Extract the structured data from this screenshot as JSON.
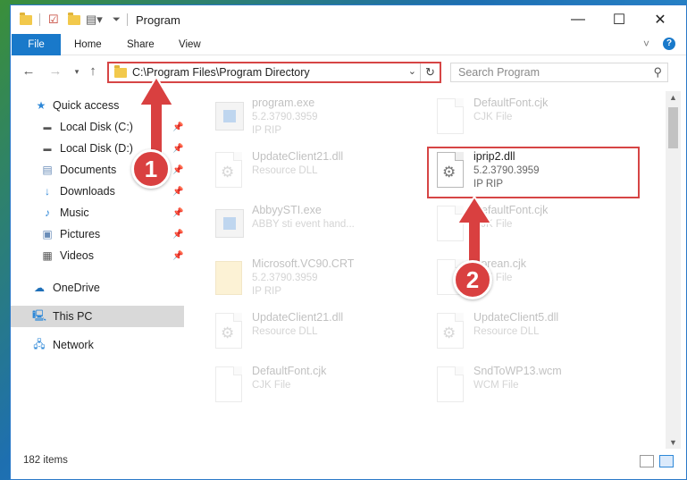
{
  "window": {
    "title": "Program",
    "controls": {
      "minimize": "—",
      "maximize": "☐",
      "close": "✕"
    }
  },
  "ribbon": {
    "tabs": [
      "File",
      "Home",
      "Share",
      "View"
    ],
    "expand_icon": "˅",
    "help_icon": "?"
  },
  "address": {
    "path": "C:\\Program Files\\Program Directory",
    "search_placeholder": "Search Program"
  },
  "sidebar": {
    "items": [
      {
        "label": "Quick access",
        "icon": "star-icon",
        "pinned": false
      },
      {
        "label": "Local Disk (C:)",
        "icon": "drive-icon",
        "pinned": true
      },
      {
        "label": "Local Disk (D:)",
        "icon": "drive-icon",
        "pinned": true
      },
      {
        "label": "Documents",
        "icon": "documents-icon",
        "pinned": true
      },
      {
        "label": "Downloads",
        "icon": "download-icon",
        "pinned": true
      },
      {
        "label": "Music",
        "icon": "music-icon",
        "pinned": true
      },
      {
        "label": "Pictures",
        "icon": "pictures-icon",
        "pinned": true
      },
      {
        "label": "Videos",
        "icon": "videos-icon",
        "pinned": true
      },
      {
        "label": "OneDrive",
        "icon": "cloud-icon",
        "pinned": false
      },
      {
        "label": "This PC",
        "icon": "pc-icon",
        "pinned": false
      },
      {
        "label": "Network",
        "icon": "network-icon",
        "pinned": false
      }
    ]
  },
  "files": [
    {
      "name": "program.exe",
      "line1": "5.2.3790.3959",
      "line2": "IP RIP",
      "icon": "exe"
    },
    {
      "name": "DefaultFont.cjk",
      "line1": "CJK File",
      "line2": "",
      "icon": "doc"
    },
    {
      "name": "UpdateClient21.dll",
      "line1": "Resource DLL",
      "line2": "",
      "icon": "dll"
    },
    {
      "name": "iprip2.dll",
      "line1": "5.2.3790.3959",
      "line2": "IP RIP",
      "icon": "dll"
    },
    {
      "name": "AbbyySTI.exe",
      "line1": "ABBY sti event hand...",
      "line2": "",
      "icon": "exe"
    },
    {
      "name": "DefaultFont.cjk",
      "line1": "CJK File",
      "line2": "",
      "icon": "doc"
    },
    {
      "name": "Microsoft.VC90.CRT",
      "line1": "5.2.3790.3959",
      "line2": "IP RIP",
      "icon": "folder"
    },
    {
      "name": "Korean.cjk",
      "line1": "CJK File",
      "line2": "",
      "icon": "doc"
    },
    {
      "name": "UpdateClient21.dll",
      "line1": "Resource DLL",
      "line2": "",
      "icon": "dll"
    },
    {
      "name": "UpdateClient5.dll",
      "line1": "Resource DLL",
      "line2": "",
      "icon": "dll"
    },
    {
      "name": "DefaultFont.cjk",
      "line1": "CJK File",
      "line2": "",
      "icon": "doc"
    },
    {
      "name": "SndToWP13.wcm",
      "line1": "WCM File",
      "line2": "",
      "icon": "doc"
    }
  ],
  "status": {
    "count": "182 items"
  },
  "callouts": {
    "step1": "1",
    "step2": "2"
  },
  "colors": {
    "accent": "#1979ca",
    "highlight": "#d64545",
    "badge": "#d94040"
  }
}
